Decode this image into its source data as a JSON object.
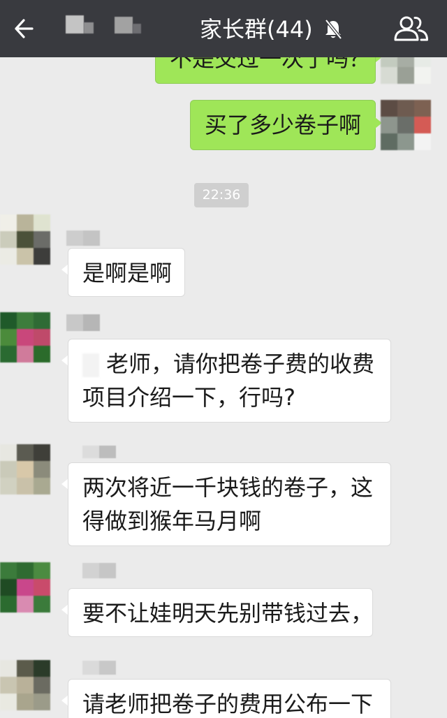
{
  "header": {
    "title": "家长群(44)",
    "back_icon": "back-arrow-icon",
    "mute_icon": "bell-off-icon",
    "members_icon": "group-members-icon"
  },
  "colors": {
    "header_bg": "#393a3f",
    "chat_bg": "#ebebeb",
    "outgoing_bubble": "#9fe658",
    "incoming_bubble": "#ffffff",
    "timestamp_bg": "#cfcfcf"
  },
  "timestamp": "22:36",
  "messages": [
    {
      "side": "outgoing",
      "lines": [
        "不是交过一次了吗？"
      ],
      "avatar_pixels": [
        "#8a7f70",
        "#6f6a60",
        "#b0a898",
        "#c3cbbf",
        "#a7ada4",
        "#e7ebe6",
        "#d7dbd3",
        "#9aa096",
        "#f2f3f0"
      ]
    },
    {
      "side": "outgoing",
      "lines": [
        "买了多少卷子啊"
      ],
      "avatar_pixels": [
        "#5c4c44",
        "#6e5b50",
        "#7d6152",
        "#8e968e",
        "#6a6e69",
        "#d45b55",
        "#5f6c62",
        "#8c978e",
        "#f3f3f3"
      ]
    },
    {
      "side": "incoming",
      "lines": [
        "是啊是啊"
      ],
      "avatar_pixels": [
        "#f0efe8",
        "#b9b49a",
        "#dfe3d0",
        "#cbccbb",
        "#4b5139",
        "#6b6c68",
        "#ebebe4",
        "#cac3a9",
        "#3d3d3b"
      ]
    },
    {
      "side": "incoming",
      "lines": [
        "老师，请你把卷子费的收费",
        "项目介绍一下，行吗?"
      ],
      "avatar_pixels": [
        "#1f5a2a",
        "#3d7d3c",
        "#2f6b35",
        "#4b8b3b",
        "#c9477b",
        "#bf4a6a",
        "#2a6a31",
        "#d07b9b",
        "#2b6b2b"
      ]
    },
    {
      "side": "incoming",
      "lines": [
        "两次将近一千块钱的卷子，这",
        "得做到猴年马月啊"
      ],
      "avatar_pixels": [
        "#e7e7e1",
        "#5b5b51",
        "#3f3f39",
        "#cacab9",
        "#d8c8a9",
        "#8b8b7b",
        "#d1d1c1",
        "#c9c1a9",
        "#a9a991"
      ]
    },
    {
      "side": "incoming",
      "lines": [
        "要不让娃明天先别带钱过去，"
      ],
      "avatar_pixels": [
        "#3b7b3b",
        "#2f6b31",
        "#4b8b41",
        "#1f4b23",
        "#c9478b",
        "#c94b6b",
        "#2b6b2f",
        "#d98bb1",
        "#3b7b3b"
      ]
    },
    {
      "side": "incoming",
      "lines": [
        "请老师把卷子的费用公布一下"
      ],
      "avatar_pixels": [
        "#e7e7e1",
        "#5b5b4b",
        "#2b3b29",
        "#c9c5b1",
        "#b9b199",
        "#6b6b61",
        "#e9e9e1",
        "#a9a58d",
        "#9b9b89"
      ]
    }
  ]
}
